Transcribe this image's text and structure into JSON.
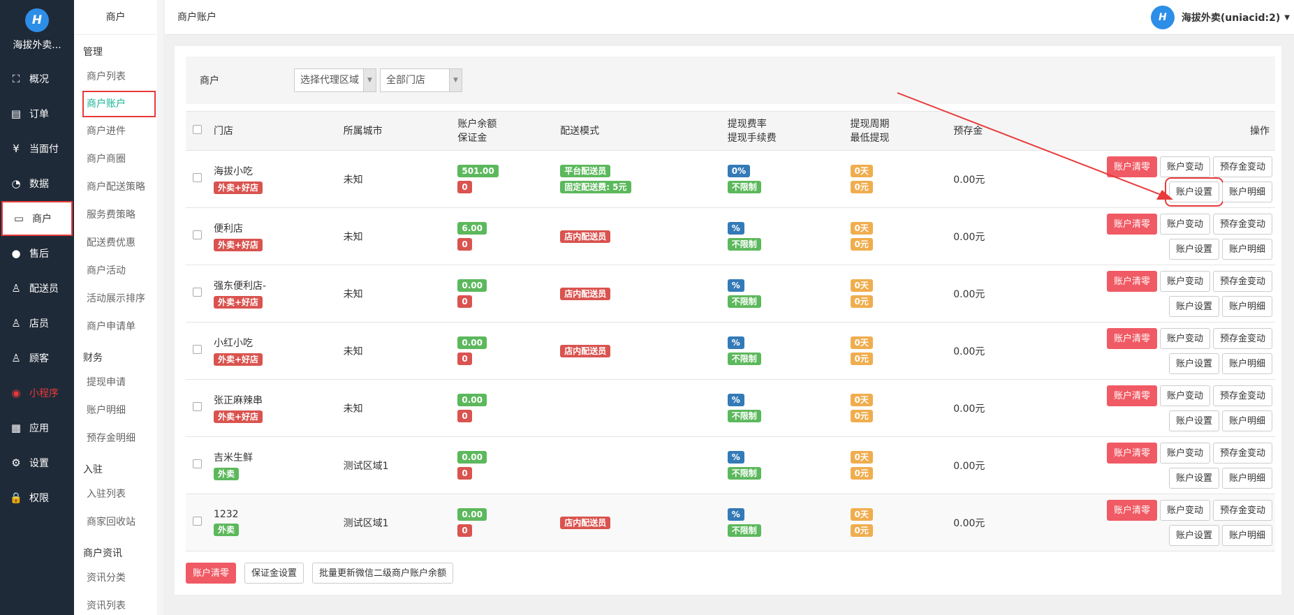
{
  "brand": {
    "name": "海拔外卖..."
  },
  "leftnav": [
    {
      "label": "概况",
      "icon": "overview-icon",
      "glyph": "⛶"
    },
    {
      "label": "订单",
      "icon": "order-icon",
      "glyph": "▤"
    },
    {
      "label": "当面付",
      "icon": "yen-icon",
      "glyph": "¥"
    },
    {
      "label": "数据",
      "icon": "chart-icon",
      "glyph": "◔"
    },
    {
      "label": "商户",
      "icon": "store-icon",
      "glyph": "▭"
    },
    {
      "label": "售后",
      "icon": "aftersale-icon",
      "glyph": "●"
    },
    {
      "label": "配送员",
      "icon": "courier-icon",
      "glyph": "♙"
    },
    {
      "label": "店员",
      "icon": "clerk-icon",
      "glyph": "♙"
    },
    {
      "label": "顾客",
      "icon": "customer-icon",
      "glyph": "♙"
    },
    {
      "label": "小程序",
      "icon": "miniprogram-icon",
      "glyph": "◉"
    },
    {
      "label": "应用",
      "icon": "apps-icon",
      "glyph": "▦"
    },
    {
      "label": "设置",
      "icon": "settings-icon",
      "glyph": "⚙"
    },
    {
      "label": "权限",
      "icon": "lock-icon",
      "glyph": "🔒"
    }
  ],
  "subnav": {
    "title": "商户",
    "groups": [
      {
        "title": "管理",
        "items": [
          "商户列表",
          "商户账户",
          "商户进件",
          "商户商圈",
          "商户配送策略",
          "服务费策略",
          "配送费优惠",
          "商户活动",
          "活动展示排序",
          "商户申请单"
        ]
      },
      {
        "title": "财务",
        "items": [
          "提现申请",
          "账户明细",
          "预存金明细"
        ]
      },
      {
        "title": "入驻",
        "items": [
          "入驻列表",
          "商家回收站"
        ]
      },
      {
        "title": "商户资讯",
        "items": [
          "资讯分类",
          "资讯列表"
        ]
      }
    ]
  },
  "topbar": {
    "title": "商户账户",
    "user": "海拔外卖(uniacid:2)"
  },
  "filter": {
    "label": "商户",
    "area_select": "选择代理区域",
    "store_select": "全部门店"
  },
  "table": {
    "headers": {
      "store": "门店",
      "city": "所属城市",
      "balance": "账户余额",
      "deposit": "保证金",
      "delivery": "配送模式",
      "fee_rate": "提现费率",
      "fee": "提现手续费",
      "period": "提现周期",
      "min": "最低提现",
      "prestore": "预存金",
      "ops": "操作"
    },
    "rows": [
      {
        "name": "海拔小吃",
        "tag": "外卖+好店",
        "city": "未知",
        "balance": "501.00",
        "deposit": "0",
        "delivery": [
          "平台配送员",
          "固定配送费: 5元"
        ],
        "delivery_color": "green",
        "rate": "0%",
        "fee": "不限制",
        "period": "0天",
        "min": "0元",
        "prestore": "0.00元"
      },
      {
        "name": "便利店",
        "tag": "外卖+好店",
        "city": "未知",
        "balance": "6.00",
        "deposit": "0",
        "delivery": [
          "店内配送员"
        ],
        "delivery_color": "red",
        "rate": "%",
        "fee": "不限制",
        "period": "0天",
        "min": "0元",
        "prestore": "0.00元"
      },
      {
        "name": "强东便利店-",
        "tag": "外卖+好店",
        "city": "未知",
        "balance": "0.00",
        "deposit": "0",
        "delivery": [
          "店内配送员"
        ],
        "delivery_color": "red",
        "rate": "%",
        "fee": "不限制",
        "period": "0天",
        "min": "0元",
        "prestore": "0.00元"
      },
      {
        "name": "小红小吃",
        "tag": "外卖+好店",
        "city": "未知",
        "balance": "0.00",
        "deposit": "0",
        "delivery": [
          "店内配送员"
        ],
        "delivery_color": "red",
        "rate": "%",
        "fee": "不限制",
        "period": "0天",
        "min": "0元",
        "prestore": "0.00元"
      },
      {
        "name": "张正麻辣串",
        "tag": "外卖+好店",
        "city": "未知",
        "balance": "0.00",
        "deposit": "0",
        "delivery": [],
        "delivery_color": "red",
        "rate": "%",
        "fee": "不限制",
        "period": "0天",
        "min": "0元",
        "prestore": "0.00元"
      },
      {
        "name": "吉米生鲜",
        "tag": "外卖",
        "city": "测试区域1",
        "balance": "0.00",
        "deposit": "0",
        "delivery": [],
        "delivery_color": "red",
        "rate": "%",
        "fee": "不限制",
        "period": "0天",
        "min": "0元",
        "prestore": "0.00元"
      },
      {
        "name": "1232",
        "tag": "外卖",
        "city": "测试区域1",
        "balance": "0.00",
        "deposit": "0",
        "delivery": [
          "店内配送员"
        ],
        "delivery_color": "red",
        "rate": "%",
        "fee": "不限制",
        "period": "0天",
        "min": "0元",
        "prestore": "0.00元"
      }
    ],
    "row_buttons": {
      "clear": "账户清零",
      "change": "账户变动",
      "prestore_change": "预存金变动",
      "settings": "账户设置",
      "detail": "账户明细"
    }
  },
  "bottom": {
    "clear": "账户清零",
    "deposit": "保证金设置",
    "batch": "批量更新微信二级商户账户余额"
  },
  "colors": {
    "nav_bg": "#1f2a38",
    "accent": "#1ab394",
    "annotation": "#e83a3a"
  }
}
